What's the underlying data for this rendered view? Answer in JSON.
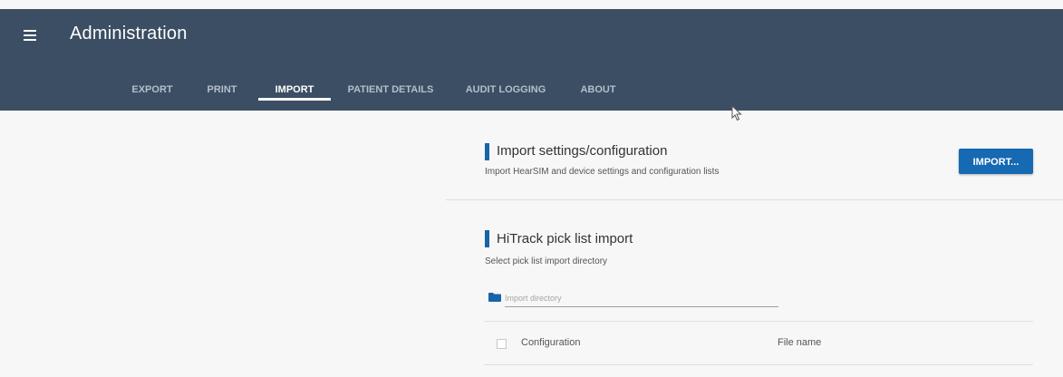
{
  "appbar": {
    "title": "Administration",
    "menu_icon": "hamburger-menu-icon",
    "background_color": "#3b4e63"
  },
  "tabs": [
    {
      "label": "EXPORT",
      "active": false
    },
    {
      "label": "PRINT",
      "active": false
    },
    {
      "label": "IMPORT",
      "active": true
    },
    {
      "label": "PATIENT DETAILS",
      "active": false
    },
    {
      "label": "AUDIT LOGGING",
      "active": false
    },
    {
      "label": "ABOUT",
      "active": false
    }
  ],
  "import_settings": {
    "title": "Import settings/configuration",
    "description": "Import HearSIM and device settings and configuration lists",
    "button_label": "IMPORT..."
  },
  "pick_list": {
    "title": "HiTrack pick list import",
    "description": "Select pick list import directory",
    "directory_icon": "folder-icon",
    "directory_placeholder": "Import directory",
    "table": {
      "columns": [
        "Configuration",
        "File name"
      ]
    }
  },
  "colors": {
    "accent": "#1665a8",
    "button": "#1669b3"
  }
}
